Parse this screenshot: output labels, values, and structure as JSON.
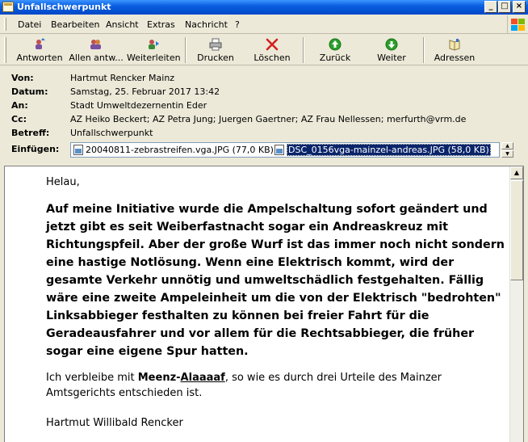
{
  "window": {
    "title": "Unfallschwerpunkt"
  },
  "menu": [
    "Datei",
    "Bearbeiten",
    "Ansicht",
    "Extras",
    "Nachricht",
    "?"
  ],
  "toolbar": {
    "reply": "Antworten",
    "reply_all": "Allen antw...",
    "forward": "Weiterleiten",
    "print": "Drucken",
    "delete": "Löschen",
    "back": "Zurück",
    "next": "Weiter",
    "addresses": "Adressen"
  },
  "header": {
    "from_label": "Von:",
    "from": "Hartmut Rencker Mainz",
    "date_label": "Datum:",
    "date": "Samstag, 25. Februar 2017 13:42",
    "to_label": "An:",
    "to": "Stadt Umweltdezernentin Eder",
    "cc_label": "Cc:",
    "cc": "AZ Heiko Beckert; AZ Petra Jung; Juergen Gaertner; AZ Frau Nellessen; merfurth@vrm.de",
    "subject_label": "Betreff:",
    "subject": "Unfallschwerpunkt",
    "attach_label": "Einfügen:",
    "attachments": [
      "20040811-zebrastreifen.vga.JPG (77,0 KB)",
      "DSC_0156vga-mainzel-andreas.JPG (58,0 KB)"
    ]
  },
  "body": {
    "greeting": "Helau,",
    "bold_paragraph": "Auf meine Initiative wurde die Ampelschaltung sofort geändert und jetzt gibt es seit Weiberfastnacht sogar ein Andreaskreuz mit Richtungspfeil. Aber der große Wurf ist das immer noch nicht sondern eine hastige Notlösung. Wenn eine Elektrisch kommt, wird der gesamte Verkehr unnötig und umweltschädlich festgehalten. Fällig wäre eine zweite Ampeleinheit um die von der Elektrisch \"bedrohten\" Linksabbieger festhalten zu können bei freier Fahrt für die Geradeausfahrer und vor allem für die Rechtsabbieger, die früher sogar eine eigene Spur hatten.",
    "closing_pre": "Ich verbleibe mit ",
    "closing_bold": "Meenz-",
    "closing_link": "Alaaaaf",
    "closing_post": ", so wie es durch drei Urteile des Mainzer Amtsgerichts entschieden ist.",
    "signature": "Hartmut Willibald Rencker"
  },
  "colors": {
    "titlebar": "#0a5fe0",
    "selection": "#0a246a",
    "delete_x": "#d42020",
    "nav_green": "#2aa02a"
  }
}
